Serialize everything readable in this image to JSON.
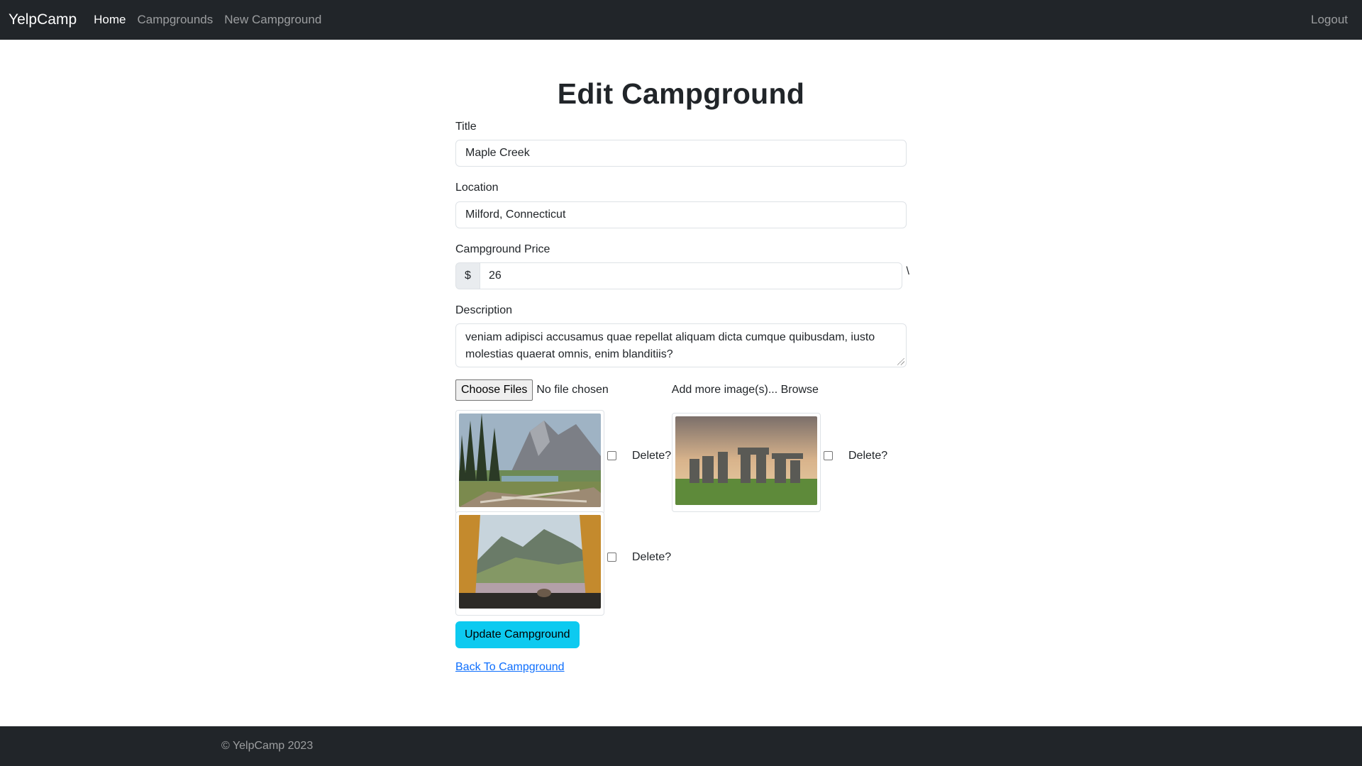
{
  "navbar": {
    "brand": "YelpCamp",
    "links": [
      {
        "label": "Home"
      },
      {
        "label": "Campgrounds"
      },
      {
        "label": "New Campground"
      }
    ],
    "logout": "Logout"
  },
  "page": {
    "title": "Edit Campground"
  },
  "form": {
    "title": {
      "label": "Title",
      "value": "Maple Creek"
    },
    "location": {
      "label": "Location",
      "value": "Milford, Connecticut"
    },
    "price": {
      "label": "Campground Price",
      "currency": "$",
      "value": "26",
      "stray": "\\"
    },
    "description": {
      "label": "Description",
      "value": "veniam adipisci accusamus quae repellat aliquam dicta cumque quibusdam, iusto molestias quaerat omnis, enim blanditiis?"
    },
    "files": {
      "button": "Choose Files",
      "status": "No file chosen",
      "hint": "Add more image(s)... Browse"
    },
    "images": [
      {
        "name": "forest-mountain-image",
        "delete_label": "Delete?"
      },
      {
        "name": "stonehenge-image",
        "delete_label": "Delete?"
      },
      {
        "name": "tent-view-image",
        "delete_label": "Delete?"
      }
    ],
    "submit": "Update Campground",
    "back": "Back To Campground"
  },
  "footer": {
    "text": "© YelpCamp 2023"
  }
}
